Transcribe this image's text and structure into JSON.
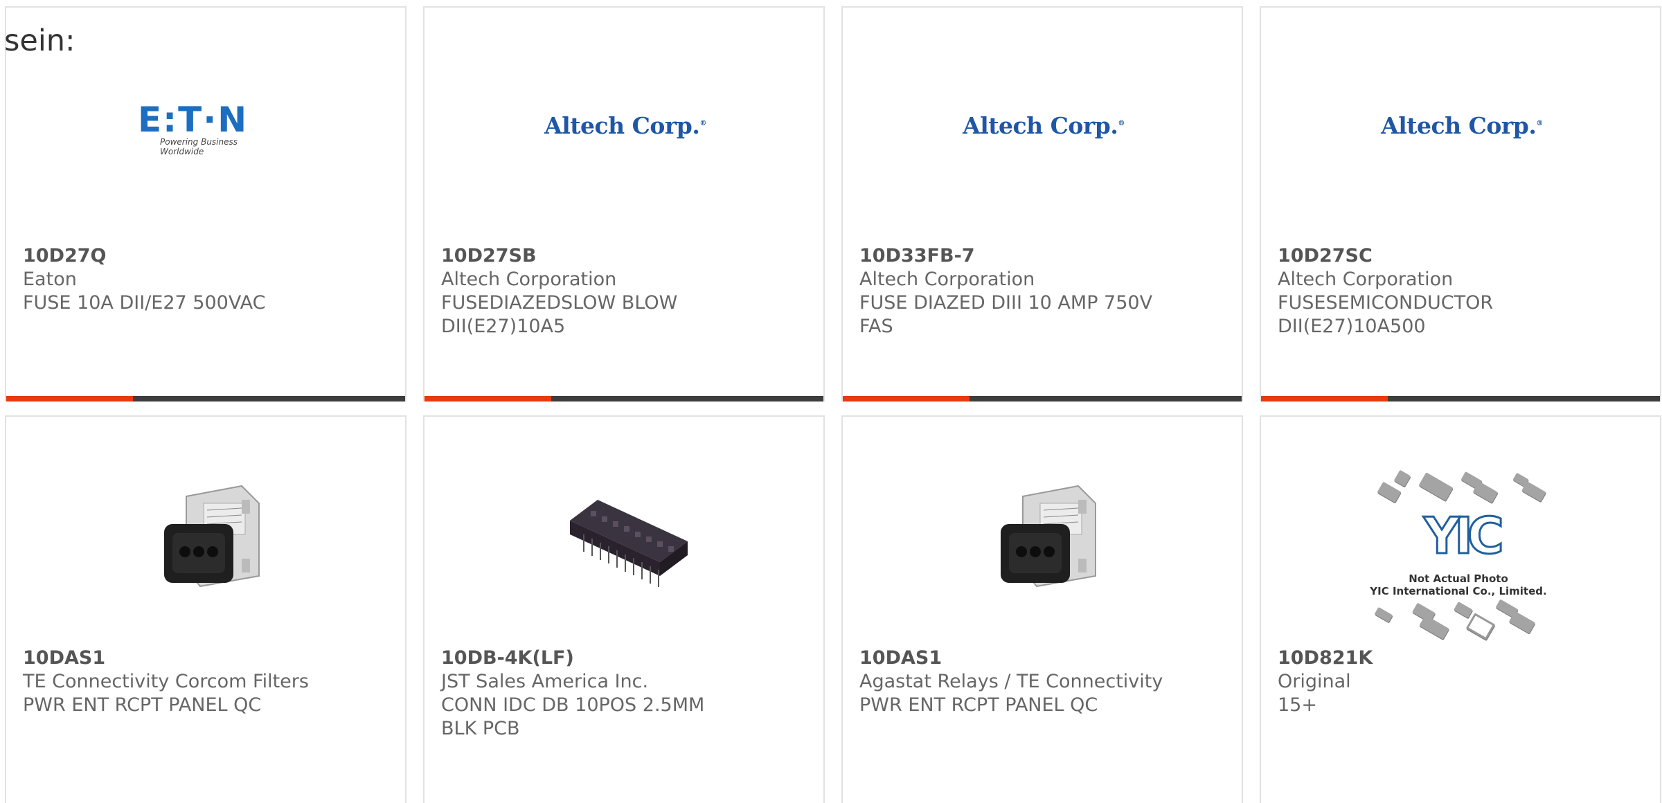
{
  "intro_text": "sein:",
  "colors": {
    "accent": "#e83a0f",
    "bar": "#3d3d3d",
    "card_border": "#e2e2e2",
    "eaton_blue": "#1c6ec0",
    "altech_blue": "#1f57a6"
  },
  "products": [
    {
      "part_number": "10D27Q",
      "manufacturer": "Eaton",
      "description": "FUSE 10A DII/E27 500VAC",
      "image": "eaton-logo"
    },
    {
      "part_number": "10D27SB",
      "manufacturer": "Altech Corporation",
      "description": "FUSEDIAZEDSLOW BLOW DII(E27)10A5",
      "image": "altech-logo"
    },
    {
      "part_number": "10D33FB-7",
      "manufacturer": "Altech Corporation",
      "description": "FUSE DIAZED DIII 10 AMP 750V FAS",
      "image": "altech-logo"
    },
    {
      "part_number": "10D27SC",
      "manufacturer": "Altech Corporation",
      "description": "FUSESEMICONDUCTOR DII(E27)10A500",
      "image": "altech-logo"
    },
    {
      "part_number": "10DAS1",
      "manufacturer": "TE Connectivity Corcom Filters",
      "description": "PWR ENT RCPT PANEL QC",
      "image": "power-entry-module-photo"
    },
    {
      "part_number": "10DB-4K(LF)",
      "manufacturer": "JST Sales America Inc.",
      "description": "CONN IDC DB 10POS 2.5MM BLK PCB",
      "image": "idc-connector-photo"
    },
    {
      "part_number": "10DAS1",
      "manufacturer": "Agastat Relays / TE Connectivity",
      "description": "PWR ENT RCPT PANEL QC",
      "image": "power-entry-module-photo"
    },
    {
      "part_number": "10D821K",
      "manufacturer": "Original",
      "description": "15+",
      "image": "yic-placeholder"
    }
  ],
  "logos": {
    "eaton_word": "E:T·N",
    "eaton_tagline": "Powering Business Worldwide",
    "altech_word": "Altech Corp.",
    "altech_mark": "®",
    "yic_word": "YIC",
    "yic_line1": "Not Actual Photo",
    "yic_line2": "YIC International Co., Limited."
  }
}
